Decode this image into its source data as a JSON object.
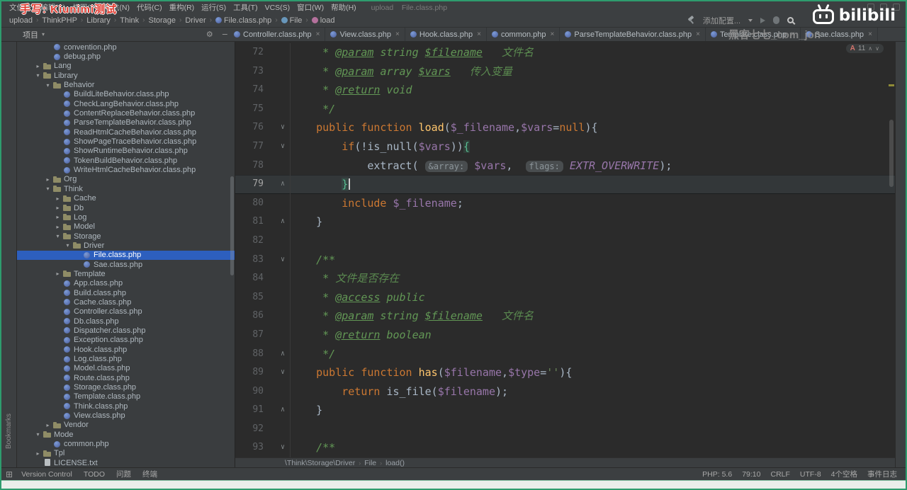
{
  "window": {
    "title": "upload    File.class.php"
  },
  "menubar": {
    "items": [
      "文件(F)",
      "编辑(E)",
      "视图(V)",
      "导航(N)",
      "代码(C)",
      "重构(R)",
      "运行(S)",
      "工具(T)",
      "VCS(S)",
      "窗口(W)",
      "帮助(H)"
    ]
  },
  "navbar": {
    "crumbs": [
      {
        "label": "upload"
      },
      {
        "label": "ThinkPHP"
      },
      {
        "label": "Library"
      },
      {
        "label": "Think"
      },
      {
        "label": "Storage"
      },
      {
        "label": "Driver"
      },
      {
        "label": "File.class.php",
        "icon": "php"
      },
      {
        "label": "File",
        "icon": "class"
      },
      {
        "label": "load",
        "icon": "method"
      }
    ],
    "add_config": "添加配置..."
  },
  "project": {
    "panel_label": "项目",
    "tool_strip_bottom": "Bookmarks",
    "tree": [
      {
        "n": "convention.php",
        "d": 3,
        "t": "php"
      },
      {
        "n": "debug.php",
        "d": 3,
        "t": "php"
      },
      {
        "n": "Lang",
        "d": 2,
        "t": "dir",
        "s": "closed"
      },
      {
        "n": "Library",
        "d": 2,
        "t": "dir",
        "s": "open"
      },
      {
        "n": "Behavior",
        "d": 3,
        "t": "dir",
        "s": "open"
      },
      {
        "n": "BuildLiteBehavior.class.php",
        "d": 4,
        "t": "php"
      },
      {
        "n": "CheckLangBehavior.class.php",
        "d": 4,
        "t": "php"
      },
      {
        "n": "ContentReplaceBehavior.class.php",
        "d": 4,
        "t": "php"
      },
      {
        "n": "ParseTemplateBehavior.class.php",
        "d": 4,
        "t": "php"
      },
      {
        "n": "ReadHtmlCacheBehavior.class.php",
        "d": 4,
        "t": "php"
      },
      {
        "n": "ShowPageTraceBehavior.class.php",
        "d": 4,
        "t": "php"
      },
      {
        "n": "ShowRuntimeBehavior.class.php",
        "d": 4,
        "t": "php"
      },
      {
        "n": "TokenBuildBehavior.class.php",
        "d": 4,
        "t": "php"
      },
      {
        "n": "WriteHtmlCacheBehavior.class.php",
        "d": 4,
        "t": "php"
      },
      {
        "n": "Org",
        "d": 3,
        "t": "dir",
        "s": "closed"
      },
      {
        "n": "Think",
        "d": 3,
        "t": "dir",
        "s": "open"
      },
      {
        "n": "Cache",
        "d": 4,
        "t": "dir",
        "s": "closed"
      },
      {
        "n": "Db",
        "d": 4,
        "t": "dir",
        "s": "closed"
      },
      {
        "n": "Log",
        "d": 4,
        "t": "dir",
        "s": "closed"
      },
      {
        "n": "Model",
        "d": 4,
        "t": "dir",
        "s": "closed"
      },
      {
        "n": "Storage",
        "d": 4,
        "t": "dir",
        "s": "open"
      },
      {
        "n": "Driver",
        "d": 5,
        "t": "dir",
        "s": "open"
      },
      {
        "n": "File.class.php",
        "d": 6,
        "t": "php",
        "sel": true
      },
      {
        "n": "Sae.class.php",
        "d": 6,
        "t": "php"
      },
      {
        "n": "Template",
        "d": 4,
        "t": "dir",
        "s": "closed"
      },
      {
        "n": "App.class.php",
        "d": 4,
        "t": "php"
      },
      {
        "n": "Build.class.php",
        "d": 4,
        "t": "php"
      },
      {
        "n": "Cache.class.php",
        "d": 4,
        "t": "php"
      },
      {
        "n": "Controller.class.php",
        "d": 4,
        "t": "php"
      },
      {
        "n": "Db.class.php",
        "d": 4,
        "t": "php"
      },
      {
        "n": "Dispatcher.class.php",
        "d": 4,
        "t": "php"
      },
      {
        "n": "Exception.class.php",
        "d": 4,
        "t": "php"
      },
      {
        "n": "Hook.class.php",
        "d": 4,
        "t": "php"
      },
      {
        "n": "Log.class.php",
        "d": 4,
        "t": "php"
      },
      {
        "n": "Model.class.php",
        "d": 4,
        "t": "php"
      },
      {
        "n": "Route.class.php",
        "d": 4,
        "t": "php"
      },
      {
        "n": "Storage.class.php",
        "d": 4,
        "t": "php"
      },
      {
        "n": "Template.class.php",
        "d": 4,
        "t": "php"
      },
      {
        "n": "Think.class.php",
        "d": 4,
        "t": "php"
      },
      {
        "n": "View.class.php",
        "d": 4,
        "t": "php"
      },
      {
        "n": "Vendor",
        "d": 3,
        "t": "dir",
        "s": "closed"
      },
      {
        "n": "Mode",
        "d": 2,
        "t": "dir",
        "s": "open"
      },
      {
        "n": "common.php",
        "d": 3,
        "t": "php"
      },
      {
        "n": "Tpl",
        "d": 2,
        "t": "dir",
        "s": "closed"
      },
      {
        "n": "LICENSE.txt",
        "d": 2,
        "t": "txt"
      }
    ]
  },
  "tabs": [
    "Controller.class.php",
    "View.class.php",
    "Hook.class.php",
    "common.php",
    "ParseTemplateBehavior.class.php",
    "Template.class.php",
    "Sae.class.php"
  ],
  "editor": {
    "inspection": {
      "letter": "A",
      "count": "11"
    },
    "breadcrumbs": [
      "\\Think\\Storage\\Driver",
      "File",
      "load()"
    ],
    "lines": [
      {
        "no": 72,
        "seg": [
          [
            "     * ",
            "doc"
          ],
          [
            "@param",
            "tag"
          ],
          [
            " ",
            "doc"
          ],
          [
            "string",
            "doc"
          ],
          [
            " ",
            "doc"
          ],
          [
            "$filename",
            "docvar"
          ],
          [
            "   文件名",
            "doccn"
          ]
        ]
      },
      {
        "no": 73,
        "seg": [
          [
            "     * ",
            "doc"
          ],
          [
            "@param",
            "tag"
          ],
          [
            " ",
            "doc"
          ],
          [
            "array",
            "doc"
          ],
          [
            " ",
            "doc"
          ],
          [
            "$vars",
            "docvar"
          ],
          [
            "   传入变量",
            "doccn"
          ]
        ]
      },
      {
        "no": 74,
        "seg": [
          [
            "     * ",
            "doc"
          ],
          [
            "@return",
            "tag"
          ],
          [
            " void",
            "doc"
          ]
        ]
      },
      {
        "no": 75,
        "seg": [
          [
            "     */",
            "doc"
          ]
        ]
      },
      {
        "no": 76,
        "fold": "down",
        "seg": [
          [
            "    ",
            "def"
          ],
          [
            "public",
            "kw"
          ],
          [
            " ",
            "def"
          ],
          [
            "function",
            "kw"
          ],
          [
            " ",
            "def"
          ],
          [
            "load",
            "fn"
          ],
          [
            "(",
            "def"
          ],
          [
            "$_filename",
            "var"
          ],
          [
            ",",
            "def"
          ],
          [
            "$vars",
            "var"
          ],
          [
            "=",
            "def"
          ],
          [
            "null",
            "kw"
          ],
          [
            "){",
            "def"
          ]
        ]
      },
      {
        "no": 77,
        "fold": "down",
        "seg": [
          [
            "        ",
            "def"
          ],
          [
            "if",
            "kw"
          ],
          [
            "(!is_null(",
            "def"
          ],
          [
            "$vars",
            "var"
          ],
          [
            "))",
            "def"
          ],
          [
            "{",
            "brace"
          ]
        ]
      },
      {
        "no": 78,
        "seg": [
          [
            "            extract( ",
            "def"
          ],
          [
            "&array:",
            "hint"
          ],
          [
            " ",
            "def"
          ],
          [
            "$vars",
            "var"
          ],
          [
            ",  ",
            "def"
          ],
          [
            "flags:",
            "hint"
          ],
          [
            " ",
            "def"
          ],
          [
            "EXTR_OVERWRITE",
            "const"
          ],
          [
            ");",
            "def"
          ]
        ]
      },
      {
        "no": 79,
        "fold": "up",
        "cur": true,
        "caret": true,
        "seg": [
          [
            "        ",
            "def"
          ],
          [
            "}",
            "brace"
          ]
        ]
      },
      {
        "no": 80,
        "seg": [
          [
            "        ",
            "def"
          ],
          [
            "include",
            "kw"
          ],
          [
            " ",
            "def"
          ],
          [
            "$_filename",
            "var"
          ],
          [
            ";",
            "def"
          ]
        ]
      },
      {
        "no": 81,
        "fold": "up",
        "seg": [
          [
            "    }",
            "def"
          ]
        ]
      },
      {
        "no": 82,
        "seg": []
      },
      {
        "no": 83,
        "fold": "down",
        "seg": [
          [
            "    /**",
            "doc"
          ]
        ]
      },
      {
        "no": 84,
        "seg": [
          [
            "     * ",
            "doc"
          ],
          [
            "文件是否存在",
            "doccn"
          ]
        ]
      },
      {
        "no": 85,
        "seg": [
          [
            "     * ",
            "doc"
          ],
          [
            "@access",
            "tag"
          ],
          [
            " public",
            "doc"
          ]
        ]
      },
      {
        "no": 86,
        "seg": [
          [
            "     * ",
            "doc"
          ],
          [
            "@param",
            "tag"
          ],
          [
            " string ",
            "doc"
          ],
          [
            "$filename",
            "docvar"
          ],
          [
            "   文件名",
            "doccn"
          ]
        ]
      },
      {
        "no": 87,
        "seg": [
          [
            "     * ",
            "doc"
          ],
          [
            "@return",
            "tag"
          ],
          [
            " boolean",
            "doc"
          ]
        ]
      },
      {
        "no": 88,
        "fold": "up",
        "seg": [
          [
            "     */",
            "doc"
          ]
        ]
      },
      {
        "no": 89,
        "fold": "down",
        "seg": [
          [
            "    ",
            "def"
          ],
          [
            "public",
            "kw"
          ],
          [
            " ",
            "def"
          ],
          [
            "function",
            "kw"
          ],
          [
            " ",
            "def"
          ],
          [
            "has",
            "fn"
          ],
          [
            "(",
            "def"
          ],
          [
            "$filename",
            "var"
          ],
          [
            ",",
            "def"
          ],
          [
            "$type",
            "var"
          ],
          [
            "=",
            "def"
          ],
          [
            "''",
            "str"
          ],
          [
            "){",
            "def"
          ]
        ]
      },
      {
        "no": 90,
        "seg": [
          [
            "        ",
            "def"
          ],
          [
            "return",
            "kw"
          ],
          [
            " is_file(",
            "def"
          ],
          [
            "$filename",
            "var"
          ],
          [
            ");",
            "def"
          ]
        ]
      },
      {
        "no": 91,
        "fold": "up",
        "seg": [
          [
            "    }",
            "def"
          ]
        ]
      },
      {
        "no": 92,
        "seg": []
      },
      {
        "no": 93,
        "fold": "down",
        "seg": [
          [
            "    /**",
            "doc"
          ]
        ]
      }
    ]
  },
  "statusbar": {
    "left": [
      "Version Control",
      "TODO",
      "问题",
      "终端"
    ],
    "right": [
      "PHP: 5.6",
      "79:10",
      "CRLF",
      "UTF-8",
      "4个空格",
      "事件日志"
    ]
  },
  "watermarks": {
    "red": "手写: Kiunimi测试",
    "gray": "黑客七七_com_jon",
    "bili": "bilibili"
  },
  "colors": {
    "frame": "#2E9C6E",
    "selection": "#2D5FBE",
    "keyword": "#CC7832",
    "function_name": "#FFC66D",
    "variable": "#9876AA",
    "doc_comment": "#629755",
    "string": "#6A8759",
    "editor_bg": "#2B2B2B",
    "panel_bg": "#3C3F41"
  }
}
